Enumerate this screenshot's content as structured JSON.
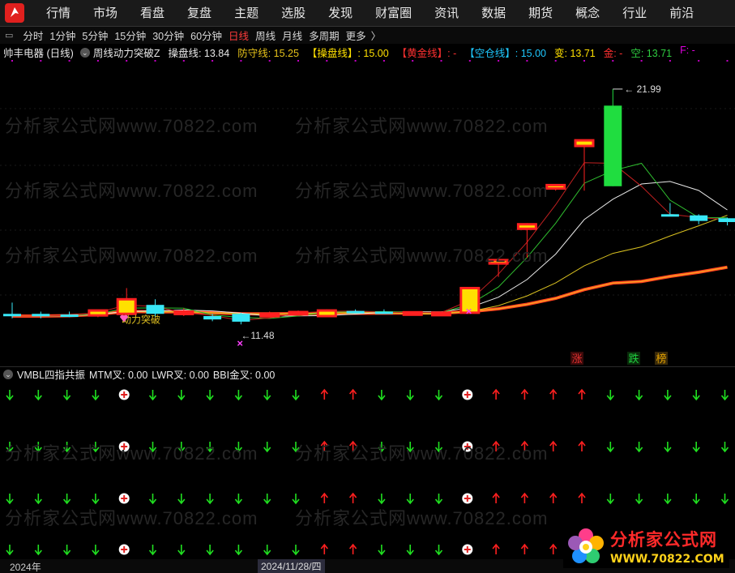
{
  "menu": [
    "行情",
    "市场",
    "看盘",
    "复盘",
    "主题",
    "选股",
    "发现",
    "财富圈",
    "资讯",
    "数据",
    "期货",
    "概念",
    "行业",
    "前沿"
  ],
  "periods": [
    {
      "label": "分时",
      "active": false
    },
    {
      "label": "1分钟",
      "active": false
    },
    {
      "label": "5分钟",
      "active": false
    },
    {
      "label": "15分钟",
      "active": false
    },
    {
      "label": "30分钟",
      "active": false
    },
    {
      "label": "60分钟",
      "active": false
    },
    {
      "label": "日线",
      "active": true
    },
    {
      "label": "周线",
      "active": false
    },
    {
      "label": "月线",
      "active": false
    },
    {
      "label": "多周期",
      "active": false
    },
    {
      "label": "更多",
      "active": false
    }
  ],
  "info": {
    "stock": "帅丰电器 (日线)",
    "formula": "周线动力突破Z",
    "items": [
      {
        "text": "操盘线: 13.84",
        "color": "#e8e8e8"
      },
      {
        "text": "防守线: 15.25",
        "color": "#e6c21a"
      },
      {
        "text": "【操盘线】: 15.00",
        "color": "#ffe000"
      },
      {
        "text": "【黄金线】: -",
        "color": "#ff3030"
      },
      {
        "text": "【空仓线】: 15.00",
        "color": "#1ec8ff"
      },
      {
        "text": "变: 13.71",
        "color": "#ffe000"
      },
      {
        "text": "金: -",
        "color": "#ff3030"
      },
      {
        "text": "空: 13.71",
        "color": "#2ecc40"
      },
      {
        "text": "F: -",
        "color": "#e000e0"
      }
    ]
  },
  "chart_data": {
    "type": "candlestick",
    "y_range": [
      10.8,
      23.0
    ],
    "candles": [
      {
        "o": 11.95,
        "h": 12.45,
        "l": 11.75,
        "c": 11.85,
        "color": "cyan"
      },
      {
        "o": 11.95,
        "h": 12.05,
        "l": 11.75,
        "c": 11.85,
        "color": "cyan"
      },
      {
        "o": 11.92,
        "h": 12.05,
        "l": 11.8,
        "c": 11.9,
        "color": "cyan"
      },
      {
        "o": 11.88,
        "h": 12.1,
        "l": 11.8,
        "c": 12.1,
        "color": "red"
      },
      {
        "o": 11.95,
        "h": 13.1,
        "l": 11.85,
        "c": 12.6,
        "color": "red"
      },
      {
        "o": 12.35,
        "h": 12.6,
        "l": 11.8,
        "c": 11.95,
        "color": "cyan"
      },
      {
        "o": 12.0,
        "h": 12.2,
        "l": 11.85,
        "c": 12.05,
        "color": "red"
      },
      {
        "o": 11.85,
        "h": 11.95,
        "l": 11.62,
        "c": 11.7,
        "color": "cyan"
      },
      {
        "o": 11.95,
        "h": 12.0,
        "l": 11.48,
        "c": 11.6,
        "color": "cyan"
      },
      {
        "o": 11.95,
        "h": 12.05,
        "l": 11.88,
        "c": 11.93,
        "color": "red"
      },
      {
        "o": 12.0,
        "h": 12.1,
        "l": 11.88,
        "c": 12.03,
        "color": "red"
      },
      {
        "o": 11.85,
        "h": 12.15,
        "l": 11.8,
        "c": 12.1,
        "color": "red"
      },
      {
        "o": 12.08,
        "h": 12.15,
        "l": 12.0,
        "c": 12.05,
        "color": "cyan"
      },
      {
        "o": 12.05,
        "h": 12.15,
        "l": 11.95,
        "c": 12.0,
        "color": "cyan"
      },
      {
        "o": 11.95,
        "h": 12.05,
        "l": 11.9,
        "c": 12.02,
        "color": "red"
      },
      {
        "o": 11.98,
        "h": 12.05,
        "l": 11.9,
        "c": 12.0,
        "color": "red"
      },
      {
        "o": 12.0,
        "h": 13.1,
        "l": 11.98,
        "c": 13.1,
        "color": "red"
      },
      {
        "o": 14.2,
        "h": 14.45,
        "l": 13.6,
        "c": 14.35,
        "color": "red"
      },
      {
        "o": 15.75,
        "h": 16.0,
        "l": 14.45,
        "c": 15.95,
        "color": "red"
      },
      {
        "o": 17.55,
        "h": 17.7,
        "l": 17.45,
        "c": 17.7,
        "color": "red"
      },
      {
        "o": 19.45,
        "h": 19.7,
        "l": 17.45,
        "c": 19.7,
        "color": "red"
      },
      {
        "o": 21.25,
        "h": 21.99,
        "l": 17.65,
        "c": 17.65,
        "color": "green"
      },
      null,
      {
        "o": 16.35,
        "h": 16.9,
        "l": 16.3,
        "c": 16.4,
        "color": "cyan"
      },
      {
        "o": 16.35,
        "h": 16.4,
        "l": 15.95,
        "c": 16.1,
        "color": "cyan"
      },
      {
        "o": 16.05,
        "h": 16.25,
        "l": 15.9,
        "c": 16.22,
        "color": "cyan"
      }
    ],
    "annotations": {
      "high": "21.99",
      "low": "11.48",
      "signal_text": "动力突破"
    },
    "markers": [
      "涨",
      "跌",
      "榜"
    ]
  },
  "indicator": {
    "name": "VMBL四指共振",
    "items": [
      "MTM叉: 0.00",
      "LWR叉: 0.00",
      "BBI金叉: 0.00"
    ],
    "columns": [
      "down",
      "down",
      "down",
      "down",
      "plus",
      "down",
      "down",
      "down",
      "down",
      "down",
      "down",
      "up",
      "up",
      "down",
      "down",
      "down",
      "plus",
      "up",
      "up",
      "up",
      "up",
      "down",
      "down",
      "down",
      "down",
      "down"
    ]
  },
  "footer": {
    "date_left": "2024年",
    "date_cursor": "2024/11/28/四"
  },
  "watermark": {
    "site": "分析家公式网www.70822.com",
    "logo_title": "分析家公式网",
    "logo_url": "WWW.70822.COM"
  },
  "colors": {
    "up": "#ff2020",
    "down": "#20e020",
    "cyan": "#38e8f8",
    "green": "#20dd40",
    "yellow": "#ffff00"
  }
}
